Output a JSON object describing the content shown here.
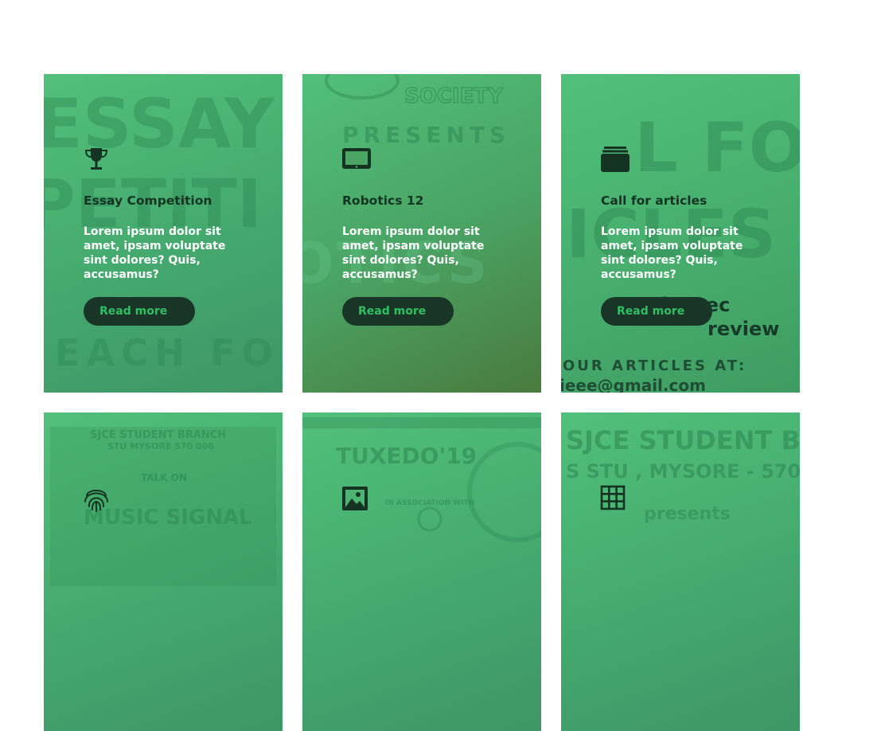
{
  "cards": [
    {
      "title": "Essay Competition",
      "description": "Lorem ipsum dolor sit amet, ipsam voluptate sint dolores? Quis, accusamus?",
      "button": "Read more",
      "icon": "trophy-icon",
      "bg_text": [
        "ESSAY",
        "PETITI",
        "EACH FOR"
      ]
    },
    {
      "title": "Robotics 12",
      "description": "Lorem ipsum dolor sit amet, ipsam voluptate sint dolores? Quis, accusamus?",
      "button": "Read more",
      "icon": "laptop-icon",
      "bg_text": [
        "SOCIETY",
        "PRESENTS",
        "OTICS"
      ]
    },
    {
      "title": "Call for articles",
      "description": "Lorem ipsum dolor sit amet, ipsam voluptate sint dolores? Quis, accusamus?",
      "button": "Read more",
      "icon": "folder-stack-icon",
      "bg_text": [
        "L FOR",
        "ICLES",
        "ite tec",
        "review",
        "OUR ARTICLES AT:",
        "ieee@gmail.com"
      ]
    },
    {
      "icon": "fingerprint-icon",
      "bg_text": [
        "SJCE STUDENT BRANCH",
        "STU MYSORE 570 006",
        "TALK ON",
        "MUSIC SIGNAL"
      ]
    },
    {
      "icon": "image-icon",
      "bg_text": [
        "TUXEDO'19",
        "IN ASSOCIATION WITH"
      ]
    },
    {
      "icon": "grid-icon",
      "bg_text": [
        "SJCE STUDENT BI",
        "S STU , MYSORE - 570",
        "presents"
      ]
    }
  ],
  "colors": {
    "card_green": "#4cb574",
    "title_dark": "#143322",
    "button_bg": "#193528",
    "button_text": "#2fbf63"
  }
}
